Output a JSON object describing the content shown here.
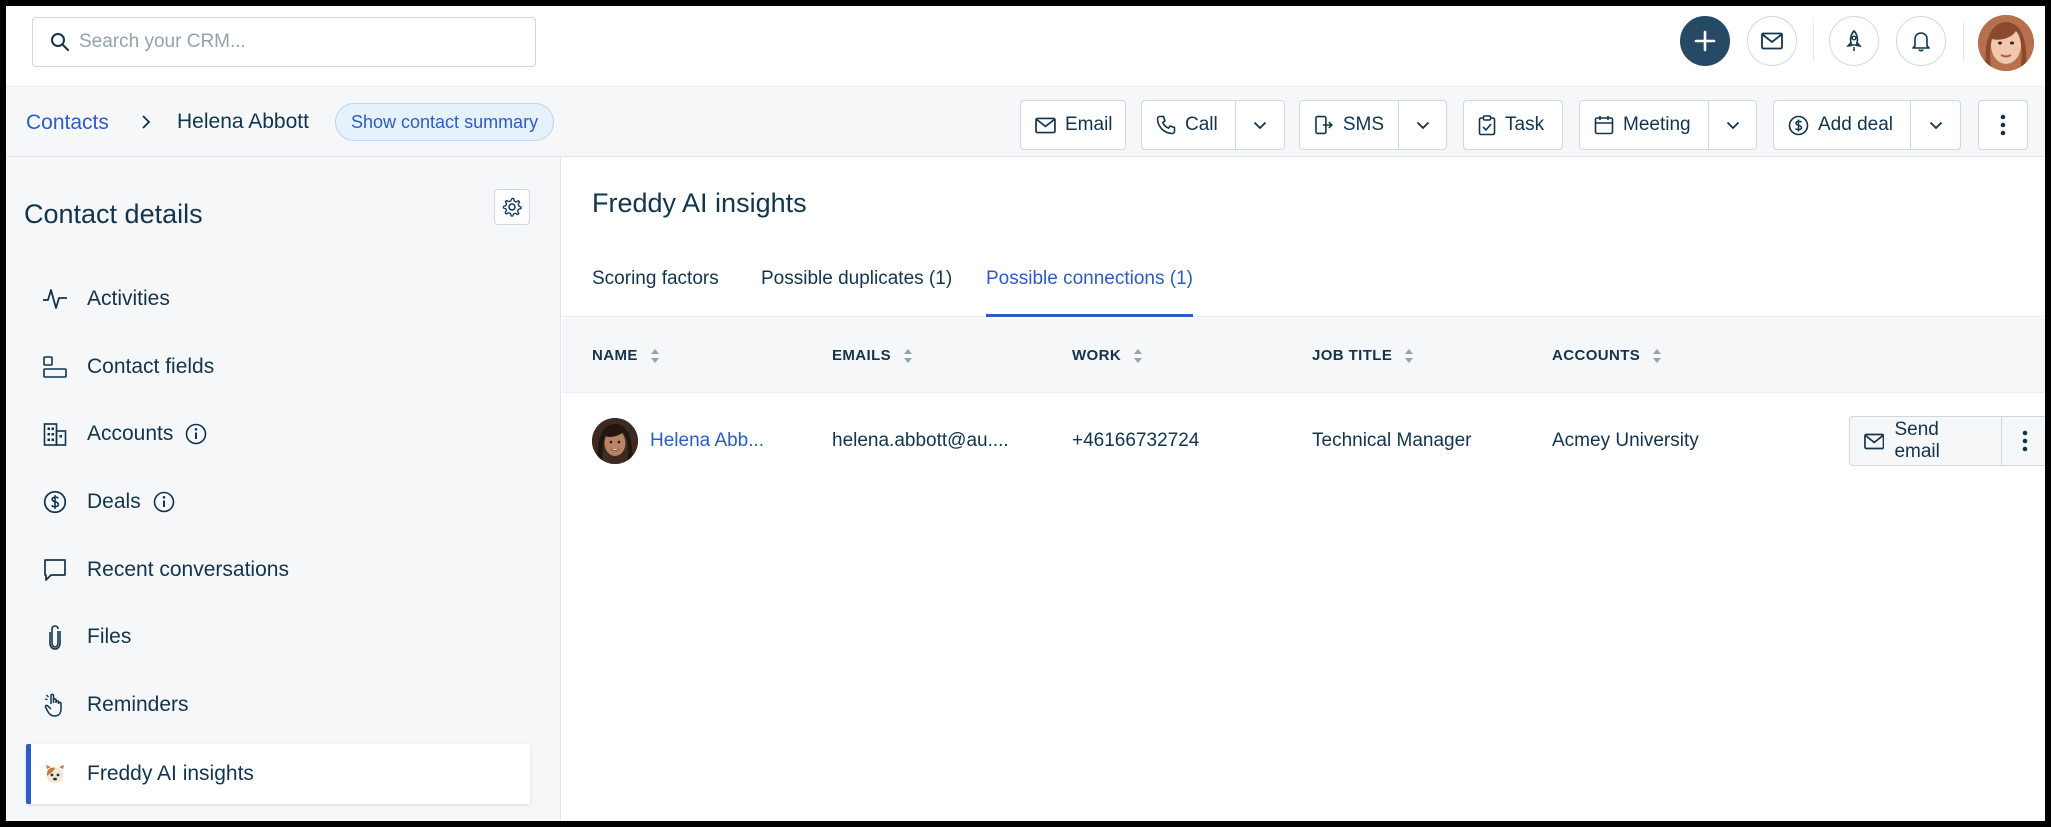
{
  "topbar": {
    "search_placeholder": "Search your CRM...",
    "icons": [
      "search-icon",
      "plus-icon",
      "mail-icon",
      "rocket-icon",
      "bell-icon",
      "user-avatar"
    ],
    "accent": "#264966"
  },
  "breadcrumb": {
    "root": "Contacts",
    "current": "Helena Abbott",
    "summary_button": "Show contact summary"
  },
  "actions": {
    "email": "Email",
    "call": "Call",
    "sms": "SMS",
    "task": "Task",
    "meeting": "Meeting",
    "add_deal": "Add deal"
  },
  "sidebar": {
    "title": "Contact details",
    "items": [
      {
        "label": "Activities",
        "icon": "activity-icon"
      },
      {
        "label": "Contact fields",
        "icon": "fields-icon"
      },
      {
        "label": "Accounts",
        "icon": "building-icon",
        "info": true
      },
      {
        "label": "Deals",
        "icon": "dollar-icon",
        "info": true
      },
      {
        "label": "Recent conversations",
        "icon": "chat-icon"
      },
      {
        "label": "Files",
        "icon": "paperclip-icon"
      },
      {
        "label": "Reminders",
        "icon": "hand-icon"
      },
      {
        "label": "Freddy AI insights",
        "icon": "freddy-icon",
        "active": true
      }
    ]
  },
  "main": {
    "title": "Freddy AI insights",
    "tabs": [
      {
        "label": "Scoring factors"
      },
      {
        "label": "Possible duplicates (1)"
      },
      {
        "label": "Possible connections (1)",
        "active": true
      }
    ],
    "columns": [
      "NAME",
      "EMAILS",
      "WORK",
      "JOB TITLE",
      "ACCOUNTS"
    ],
    "rows": [
      {
        "name": "Helena Abb...",
        "email": "helena.abbott@au....",
        "work": "+46166732724",
        "job_title": "Technical Manager",
        "account": "Acmey University",
        "action": "Send email"
      }
    ]
  },
  "colors": {
    "link": "#2c5cc5",
    "text": "#12344d",
    "panel": "#f5f7f9",
    "border": "#cfd7df"
  }
}
